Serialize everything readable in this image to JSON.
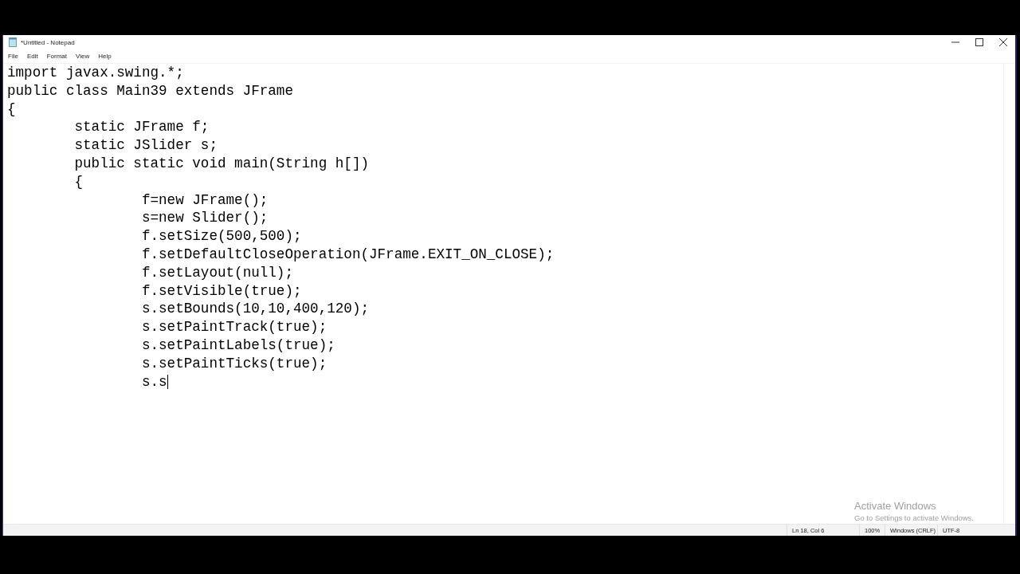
{
  "window": {
    "title": "*Untitled - Notepad"
  },
  "menu": [
    "File",
    "Edit",
    "Format",
    "View",
    "Help"
  ],
  "editor": {
    "lines": [
      "import javax.swing.*;",
      "public class Main39 extends JFrame",
      "{",
      "\tstatic JFrame f;",
      "\tstatic JSlider s;",
      "\tpublic static void main(String h[])",
      "\t{",
      "\t\tf=new JFrame();",
      "\t\ts=new Slider();",
      "\t\tf.setSize(500,500);",
      "\t\tf.setDefaultCloseOperation(JFrame.EXIT_ON_CLOSE);",
      "\t\tf.setLayout(null);",
      "\t\tf.setVisible(true);",
      "\t\ts.setBounds(10,10,400,120);",
      "\t\ts.setPaintTrack(true);",
      "\t\ts.setPaintLabels(true);",
      "\t\ts.setPaintTicks(true);",
      "\t\ts.s"
    ]
  },
  "activation_notice": {
    "title": "Activate Windows",
    "subtitle": "Go to Settings to activate Windows."
  },
  "status_bar": [
    "Ln 18, Col 6",
    "100%",
    "Windows (CRLF)",
    "UTF-8"
  ]
}
